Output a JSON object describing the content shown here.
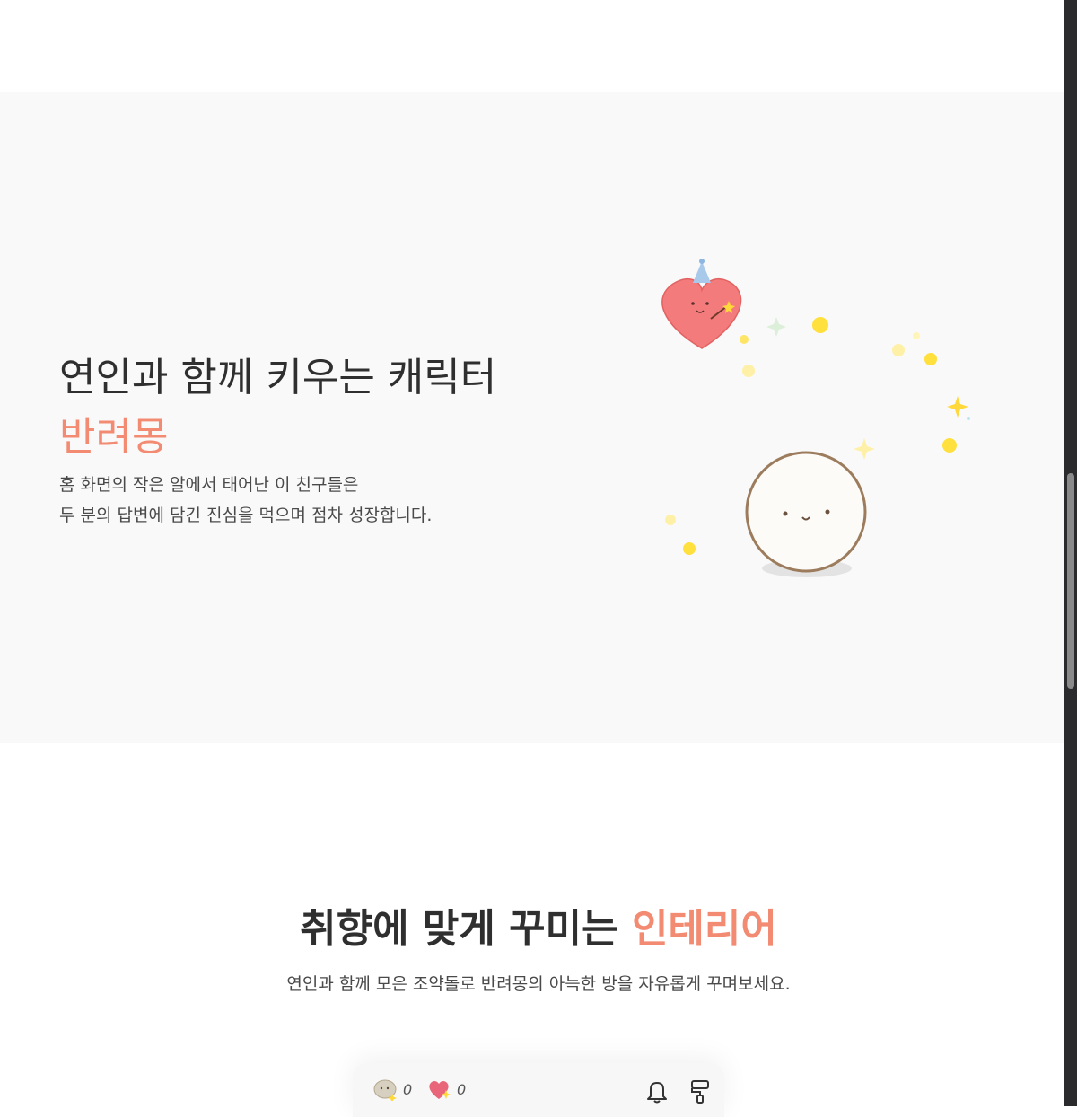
{
  "companion_section": {
    "title_line1": "연인과 함께 키우는 캐릭터",
    "title_highlight": "반려몽",
    "desc_line1": "홈 화면의 작은 알에서 태어난 이 친구들은",
    "desc_line2": "두 분의 답변에 담긴 진심을 먹으며 점차 성장합니다."
  },
  "interior_section": {
    "title_prefix": "취향에 맞게 꾸미는 ",
    "title_highlight": "인테리어",
    "description": "연인과 함께 모은 조약돌로 반려몽의 아늑한 방을 자유롭게 꾸며보세요.",
    "app_preview": {
      "stone_count": "0",
      "heart_count": "0"
    }
  },
  "colors": {
    "accent": "#f28b72",
    "section_bg": "#f9f9f9",
    "text_dark": "#2f2f2f",
    "heart": "#f47b7b",
    "sparkle": "#ffd93b"
  },
  "icons": [
    "heart-character-icon",
    "sparkle-icon",
    "egg-character-icon",
    "pebble-icon",
    "heart-icon",
    "bell-icon",
    "paint-roller-icon"
  ]
}
